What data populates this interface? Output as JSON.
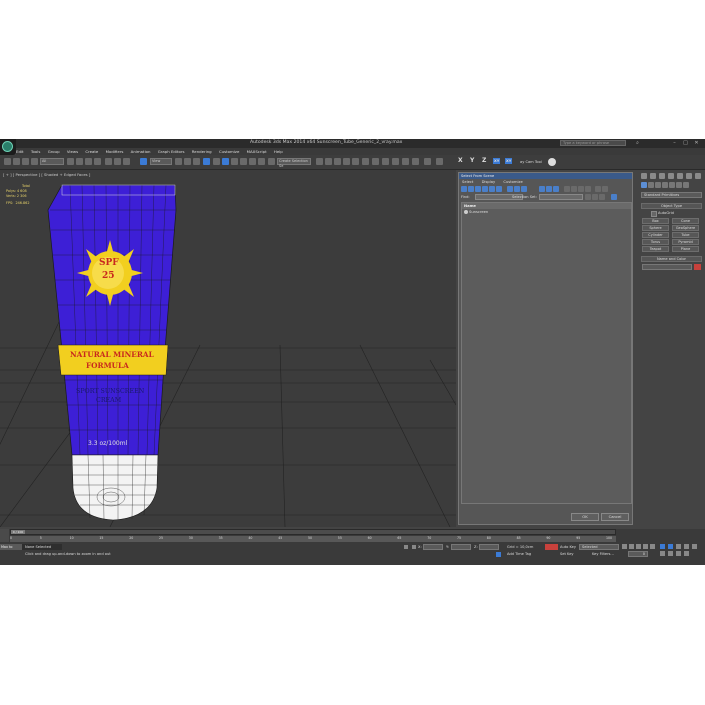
{
  "window": {
    "title": "Autodesk 3ds Max 2014 x64     Sunscreen_Tube_Generic_2_vray.max",
    "search_placeholder": "Type a keyword or phrase"
  },
  "menu": [
    "Edit",
    "Tools",
    "Group",
    "Views",
    "Create",
    "Modifiers",
    "Animation",
    "Graph Editors",
    "Rendering",
    "Customize",
    "MAXScript",
    "Help"
  ],
  "toolbar": {
    "filter_label": "All",
    "view_label": "View",
    "create_selection_label": "Create Selection Se",
    "axes": [
      "X",
      "Y",
      "Z",
      "XY",
      "XY"
    ],
    "cam_label": "ay Cam Tool"
  },
  "viewport": {
    "label": "[ + ] [ Perspective ] [ Shaded + Edged Faces ]",
    "stats": {
      "total_label": "Total",
      "polys_label": "Polys:",
      "polys": "4 608",
      "verts_label": "Verts:",
      "verts": "2 306",
      "fps_label": "FPS:",
      "fps": "246.862"
    },
    "tube_text": {
      "spf": "SPF",
      "spf_value": "25",
      "band_line1": "NATURAL MINERAL",
      "band_line2": "FORMULA",
      "desc_line1": "SPORT SUNSCREEN",
      "desc_line2": "CREAM",
      "volume": "3.3 oz/100ml"
    },
    "colors": {
      "tube": "#3d1fd6",
      "band": "#f2cf1f",
      "sun": "#f2cf1f",
      "sun_text": "#c8281e",
      "cap": "#ffffff",
      "wire": "#1a1a1a"
    }
  },
  "scene_explorer": {
    "title": "Select From Scene",
    "menu": [
      "Select",
      "Display",
      "Customize"
    ],
    "find_label": "Find:",
    "selection_set_label": "Selection Set:",
    "column_header": "Name",
    "rows": [
      "Sunscreen"
    ],
    "ok_label": "OK",
    "cancel_label": "Cancel"
  },
  "command_panel": {
    "category": "Standard Primitives",
    "object_type_header": "Object Type",
    "autogrid_label": "AutoGrid",
    "objects": [
      "Box",
      "Cone",
      "Sphere",
      "GeoSphere",
      "Cylinder",
      "Tube",
      "Torus",
      "Pyramid",
      "Teapot",
      "Plane"
    ],
    "name_color_header": "Name and Color",
    "color_swatch": "#c8413c"
  },
  "timeline": {
    "frame_counter": "0 / 100",
    "ticks": [
      "0",
      "5",
      "10",
      "15",
      "20",
      "25",
      "30",
      "35",
      "40",
      "45",
      "50",
      "55",
      "60",
      "65",
      "70",
      "75",
      "80",
      "85",
      "90",
      "95",
      "100"
    ]
  },
  "status": {
    "script_label": "Max to",
    "selection_status": "None Selected",
    "prompt": "Click and drag up-and-down to zoom in and out",
    "x_label": "X:",
    "y_label": "Y:",
    "z_label": "Z:",
    "grid": "Grid = 10,0cm",
    "add_time_tag": "Add Time Tag",
    "auto_key": "Auto Key",
    "selected_label": "Selected",
    "set_key": "Set Key",
    "key_filters": "Key Filters...",
    "frame_field": "0"
  }
}
